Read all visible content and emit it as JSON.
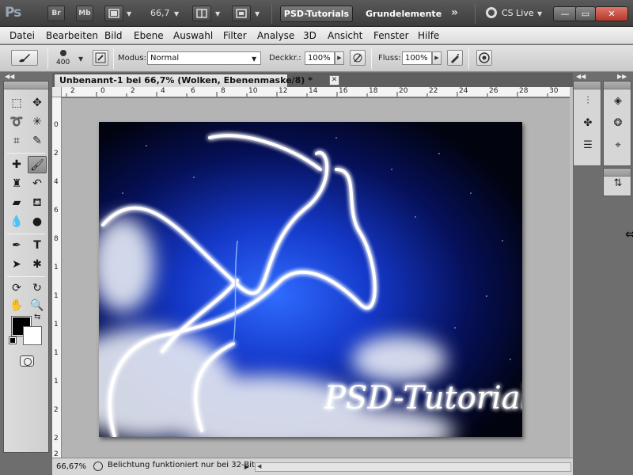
{
  "appbar": {
    "logo": "Ps",
    "bridge_label": "Br",
    "minibridge_label": "Mb",
    "zoom_value": "66,7",
    "workspace_active": "PSD-Tutorials",
    "workspace_item": "Grundelemente",
    "more_glyph": "»",
    "cslive_label": "CS Live",
    "minimize_glyph": "—",
    "restore_glyph": "▭",
    "close_glyph": "✕"
  },
  "menu": {
    "items": [
      "Datei",
      "Bearbeiten",
      "Bild",
      "Ebene",
      "Auswahl",
      "Filter",
      "Analyse",
      "3D",
      "Ansicht",
      "Fenster",
      "Hilfe"
    ]
  },
  "options": {
    "brush_size": "400",
    "mode_label": "Modus:",
    "mode_value": "Normal",
    "opacity_label": "Deckkr.:",
    "opacity_value": "100%",
    "flow_label": "Fluss:",
    "flow_value": "100%"
  },
  "document": {
    "tab_title": "Unbenannt-1 bei 66,7% (Wolken, Ebenenmaske/8) *",
    "tab_close": "✕",
    "artwork_text": "PSD-Tutorials.de",
    "ruler_h_ticks": [
      "2",
      "0",
      "2",
      "4",
      "6",
      "8",
      "10",
      "12",
      "14",
      "16",
      "18",
      "20",
      "22",
      "24",
      "26",
      "28",
      "30"
    ],
    "ruler_v_ticks": [
      "0",
      "2",
      "4",
      "6",
      "8",
      "1",
      "1",
      "1",
      "1",
      "1",
      "2",
      "2",
      "2"
    ]
  },
  "statusbar": {
    "zoom": "66,67%",
    "message": "Belichtung funktioniert nur bei 32-Bit",
    "arrow": "▶",
    "left_arrow": "◀"
  },
  "colors": {
    "foreground": "#000000",
    "background": "#ffffff",
    "workspace_button": "#6a6a6a",
    "canvas_bg": "#b4b4b4",
    "artwork_blue": "#1e4bd8"
  }
}
